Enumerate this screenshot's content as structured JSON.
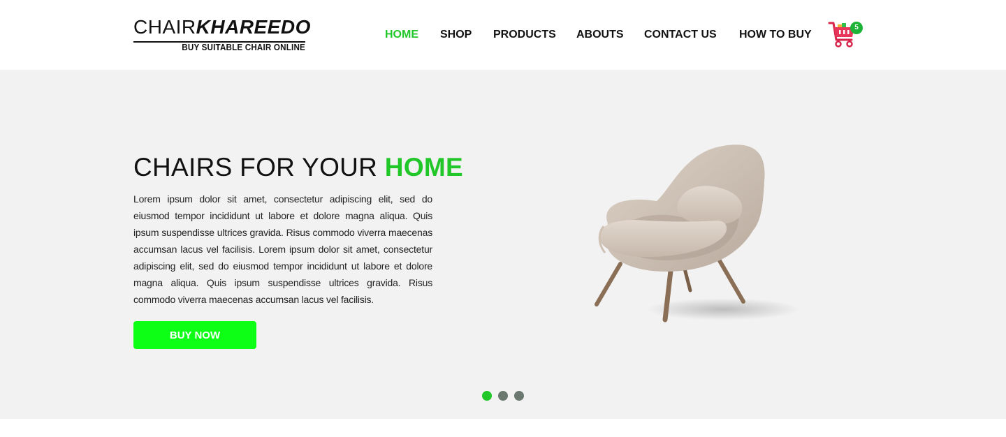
{
  "logo": {
    "brand_light": "CHAIR",
    "brand_bold": "KHAREEDO",
    "tagline": "BUY SUITABLE CHAIR ONLINE"
  },
  "nav": {
    "items": [
      {
        "label": "HOME",
        "active": true
      },
      {
        "label": "SHOP",
        "active": false
      },
      {
        "label": "PRODUCTS",
        "active": false
      },
      {
        "label": "ABOUTS",
        "active": false
      },
      {
        "label": "CONTACT US",
        "active": false
      },
      {
        "label": "HOW TO BUY",
        "active": false
      }
    ]
  },
  "cart": {
    "icon": "shopping-cart-icon",
    "count": "5"
  },
  "hero": {
    "title_plain": "CHAIRS FOR YOUR",
    "title_highlight": "HOME",
    "description": "Lorem ipsum dolor sit amet, consectetur adipiscing elit, sed do eiusmod tempor incididunt ut labore et dolore magna aliqua. Quis ipsum suspendisse ultrices gravida. Risus commodo viverra maecenas accumsan lacus vel facilisis. Lorem ipsum dolor sit amet, consectetur adipiscing elit, sed do eiusmod tempor incididunt ut labore et dolore magna aliqua. Quis ipsum suspendisse ultrices gravida. Risus commodo viverra maecenas accumsan lacus vel facilisis.",
    "button_label": "BUY NOW",
    "slides_total": 3,
    "slide_active": 1
  },
  "colors": {
    "accent": "#21c729",
    "button": "#0eff16",
    "hero_bg": "#f2f2f2",
    "dot_inactive": "#6b7870"
  }
}
